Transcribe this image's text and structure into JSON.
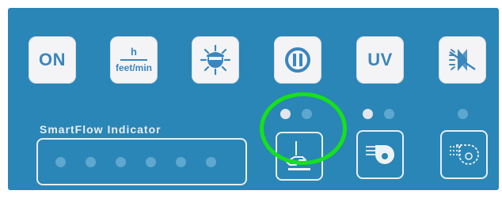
{
  "keys": {
    "on_label": "ON",
    "speed_top": "h",
    "speed_bottom": "feet/min",
    "uv_label": "UV"
  },
  "indicator": {
    "label": "SmartFlow Indicator",
    "dot_count": 6
  },
  "leds": {
    "group1": [
      "on",
      "off"
    ],
    "group2": [
      "on",
      "off"
    ],
    "group3": [
      "off"
    ]
  },
  "icons": {
    "light": "light-bulb-icon",
    "pause": "pause-icon",
    "fan_off": "fan-off-icon",
    "sash": "sash-hand-icon",
    "blower": "blower-on-icon",
    "blower_off": "blower-off-icon"
  },
  "colors": {
    "panel": "#2a86b6",
    "key_text": "#3b86bd",
    "led_on": "#e3e6ea",
    "led_off": "#5ea7cf",
    "highlight": "#16e11a"
  }
}
